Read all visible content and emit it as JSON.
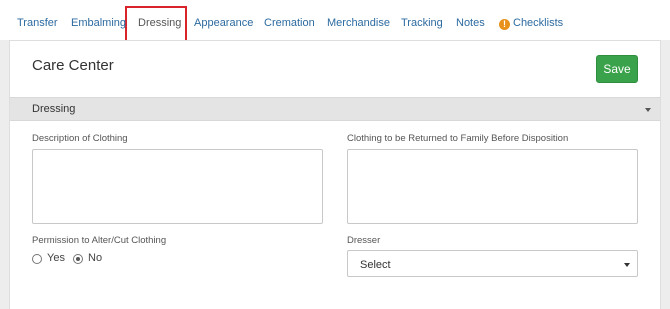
{
  "tabs": [
    {
      "label": "Transfer",
      "active": false
    },
    {
      "label": "Embalming",
      "active": false
    },
    {
      "label": "Dressing",
      "active": true
    },
    {
      "label": "Appearance",
      "active": false
    },
    {
      "label": "Cremation",
      "active": false
    },
    {
      "label": "Merchandise",
      "active": false
    },
    {
      "label": "Tracking",
      "active": false
    },
    {
      "label": "Notes",
      "active": false
    },
    {
      "label": "Checklists",
      "active": false,
      "icon": "warning-icon"
    }
  ],
  "warning_icon_glyph": "!",
  "panel": {
    "title": "Care Center",
    "save_label": "Save"
  },
  "section": {
    "label": "Dressing"
  },
  "fields": {
    "description_label": "Description of Clothing",
    "description_value": "",
    "returned_label": "Clothing to be Returned to Family Before Disposition",
    "returned_value": "",
    "permission_label": "Permission to Alter/Cut Clothing",
    "permission_options": [
      "Yes",
      "No"
    ],
    "permission_selected": "No",
    "dresser_label": "Dresser",
    "dresser_value": "Select"
  },
  "colors": {
    "link": "#2c6aa0",
    "save_button": "#3aa24a",
    "highlight_box": "#d9232a",
    "warning": "#e8911d"
  }
}
